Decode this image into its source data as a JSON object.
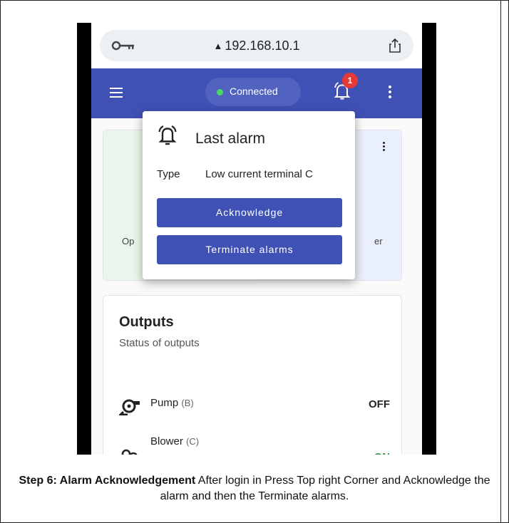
{
  "browser": {
    "url": "192.168.10.1",
    "warning_glyph": "▲",
    "key_icon": "key-icon",
    "share_icon": "share-icon"
  },
  "appbar": {
    "menu_icon": "menu-icon",
    "status": "Connected",
    "status_color": "#4cd964",
    "badge_count": "1",
    "bar_color": "#3f51b5"
  },
  "background_card": {
    "left_fragment": "Op",
    "right_fragment": "er"
  },
  "popup": {
    "title": "Last alarm",
    "type_label": "Type",
    "type_value": "Low current terminal C",
    "acknowledge_label": "Acknowledge",
    "terminate_label": "Terminate alarms"
  },
  "outputs": {
    "title": "Outputs",
    "subtitle": "Status of outputs",
    "items": [
      {
        "name": "Pump",
        "code": "(B)",
        "state": "OFF",
        "icon": "pump-icon"
      },
      {
        "name": "Blower",
        "code": "(C)",
        "state": "ON",
        "icon": "blower-icon"
      }
    ]
  },
  "caption": {
    "step": "Step 6: Alarm Acknowledgement",
    "text": " After login in Press Top right Corner and Acknowledge the alarm and then the Terminate alarms."
  }
}
